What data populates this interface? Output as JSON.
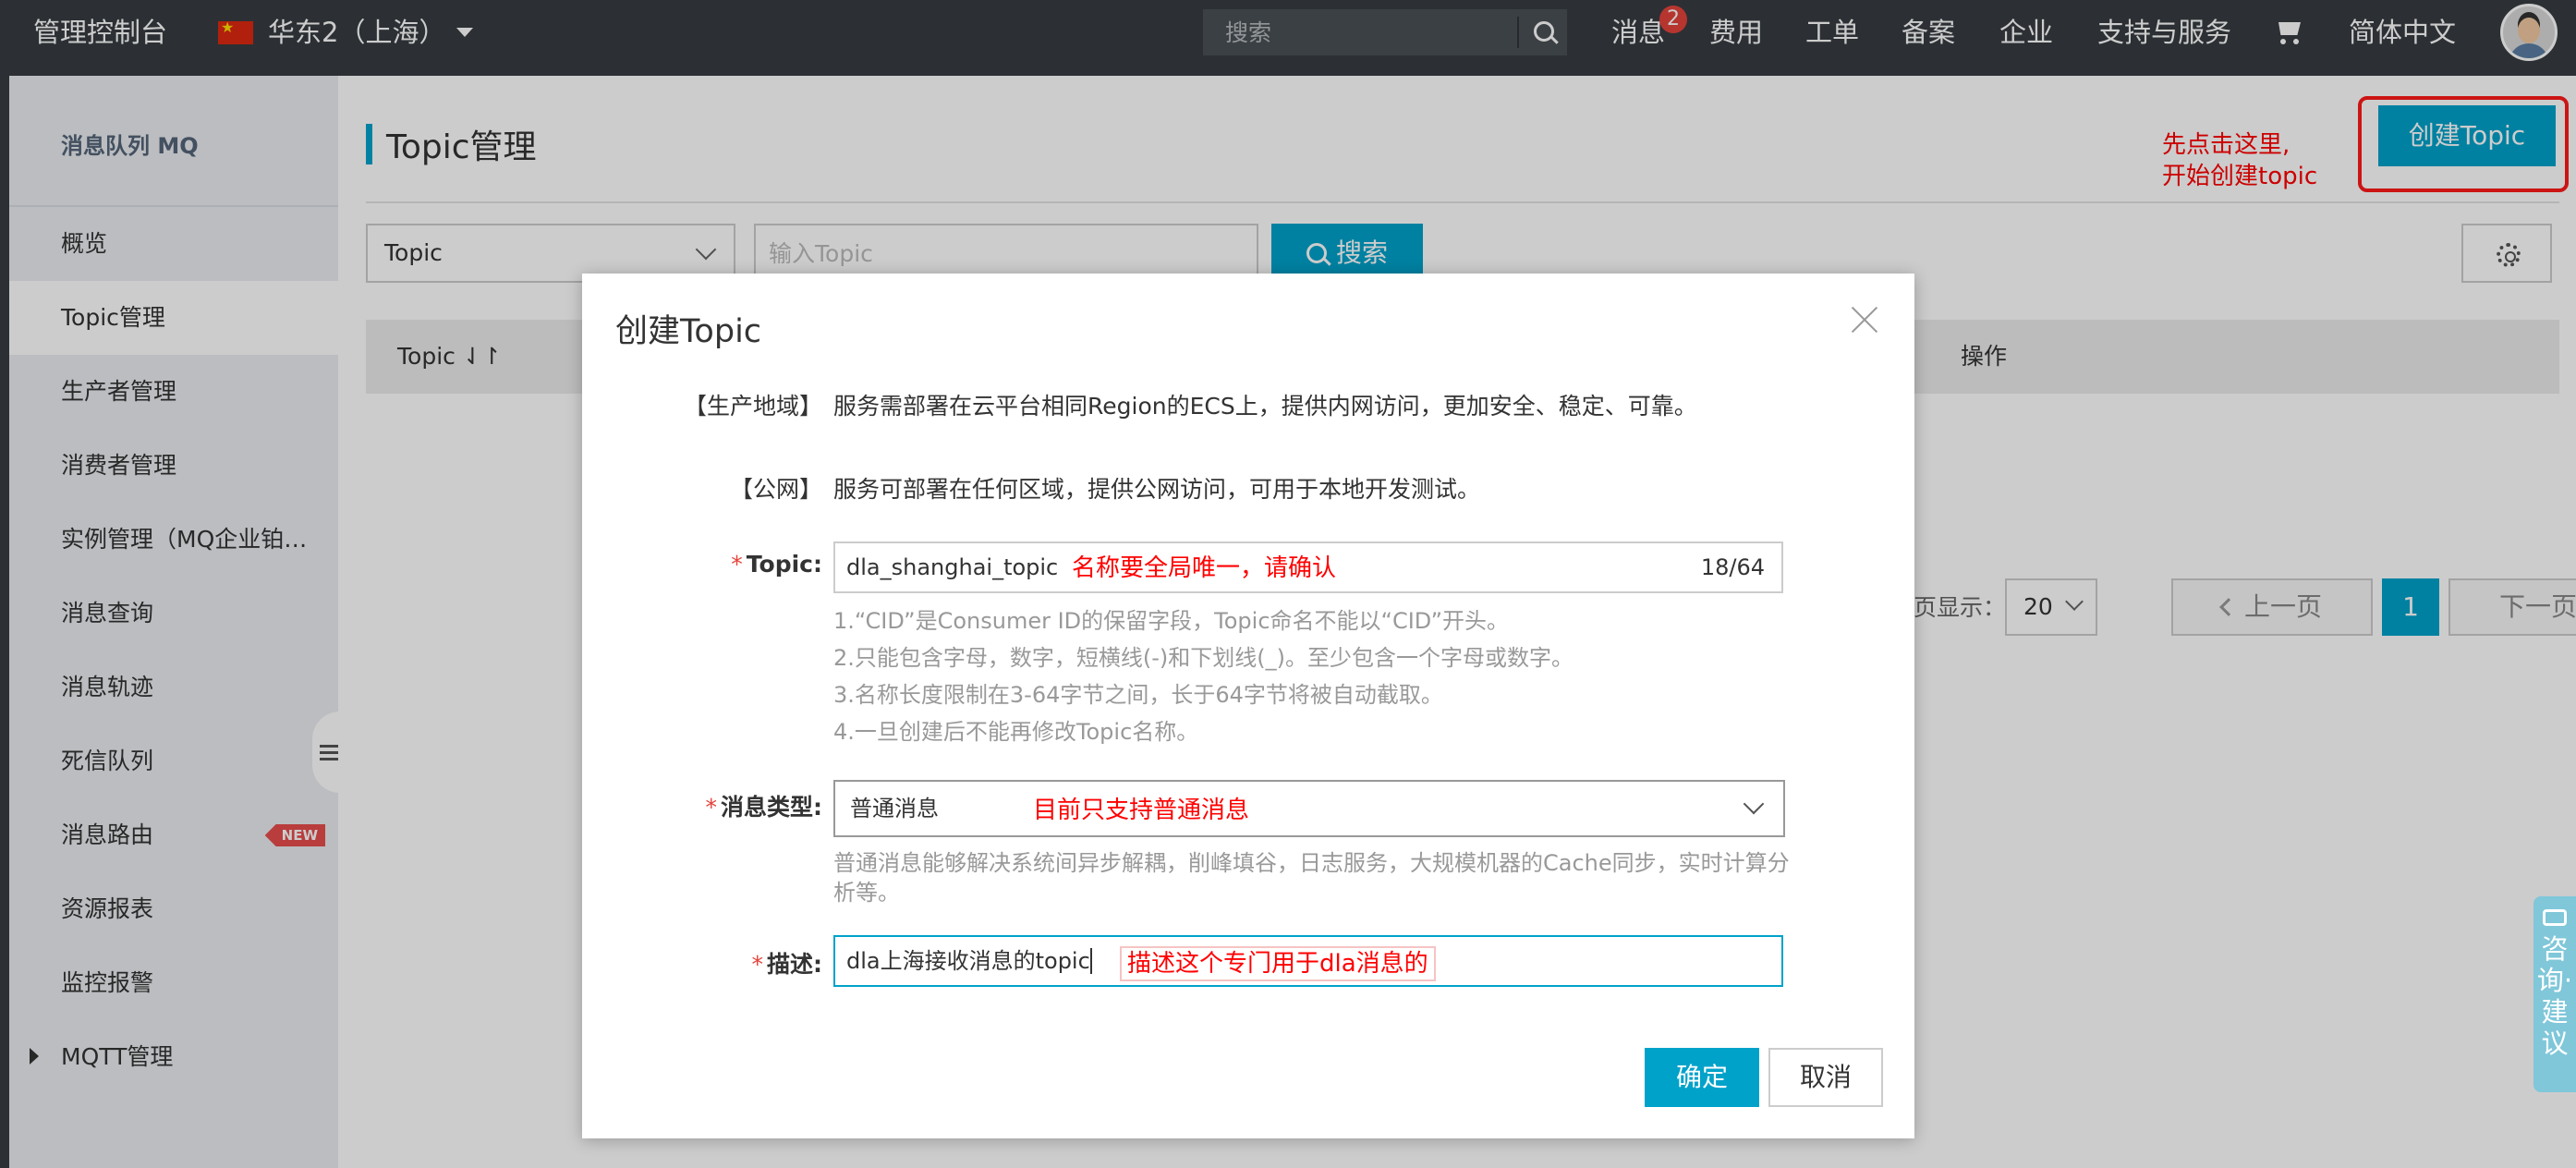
{
  "topbar": {
    "brand": "管理控制台",
    "region": "华东2（上海）",
    "search_placeholder": "搜索",
    "messages_label": "消息",
    "messages_badge": "2",
    "nav": [
      "费用",
      "工单",
      "备案",
      "企业",
      "支持与服务"
    ],
    "language": "简体中文"
  },
  "sidebar": {
    "title": "消息队列 MQ",
    "items": [
      {
        "label": "概览"
      },
      {
        "label": "Topic管理"
      },
      {
        "label": "生产者管理"
      },
      {
        "label": "消费者管理"
      },
      {
        "label": "实例管理（MQ企业铂…"
      },
      {
        "label": "消息查询"
      },
      {
        "label": "消息轨迹"
      },
      {
        "label": "死信队列"
      },
      {
        "label": "消息路由",
        "badge": "NEW"
      },
      {
        "label": "资源报表"
      },
      {
        "label": "监控报警"
      },
      {
        "label": "MQTT管理"
      }
    ],
    "active_index": 1
  },
  "main": {
    "title": "Topic管理",
    "create_button": "创建Topic",
    "create_note_line1": "先点击这里,",
    "create_note_line2": "开始创建topic",
    "filter_select": "Topic",
    "filter_placeholder": "输入Topic",
    "search_button": "搜索",
    "table_headers": [
      "Topic ⇃↾",
      "操作"
    ],
    "pager": {
      "page_size_label": "每页显示：",
      "page_size": "20",
      "prev": "上一页",
      "current": "1",
      "next": "下一页"
    }
  },
  "feedback": {
    "label": "咨询·建议"
  },
  "dialog": {
    "title": "创建Topic",
    "region_label": "【生产地域】",
    "region_desc": "服务需部署在云平台相同Region的ECS上，提供内网访问，更加安全、稳定、可靠。",
    "public_label": "【公网】",
    "public_desc": "服务可部署在任何区域，提供公网访问，可用于本地开发测试。",
    "topic_label": "Topic:",
    "topic_value": "dla_shanghai_topic",
    "topic_count": "18/64",
    "topic_annotation": "名称要全局唯一，请确认",
    "topic_hints": [
      "1.“CID”是Consumer ID的保留字段，Topic命名不能以“CID”开头。",
      "2.只能包含字母，数字，短横线(-)和下划线(_)。至少包含一个字母或数字。",
      "3.名称长度限制在3-64字节之间，长于64字节将被自动截取。",
      "4.一旦创建后不能再修改Topic名称。"
    ],
    "type_label": "消息类型:",
    "type_value": "普通消息",
    "type_annotation": "目前只支持普通消息",
    "type_hint": "普通消息能够解决系统间异步解耦，削峰填谷，日志服务，大规模机器的Cache同步，实时计算分析等。",
    "desc_label": "描述:",
    "desc_value": "dla上海接收消息的topic",
    "desc_annotation": "描述这个专门用于dla消息的",
    "ok_button": "确定",
    "cancel_button": "取消"
  },
  "colors": {
    "topbar": "#373d41",
    "accent": "#00a2ca",
    "annotation": "#ff0000",
    "required": "#e5433b"
  }
}
